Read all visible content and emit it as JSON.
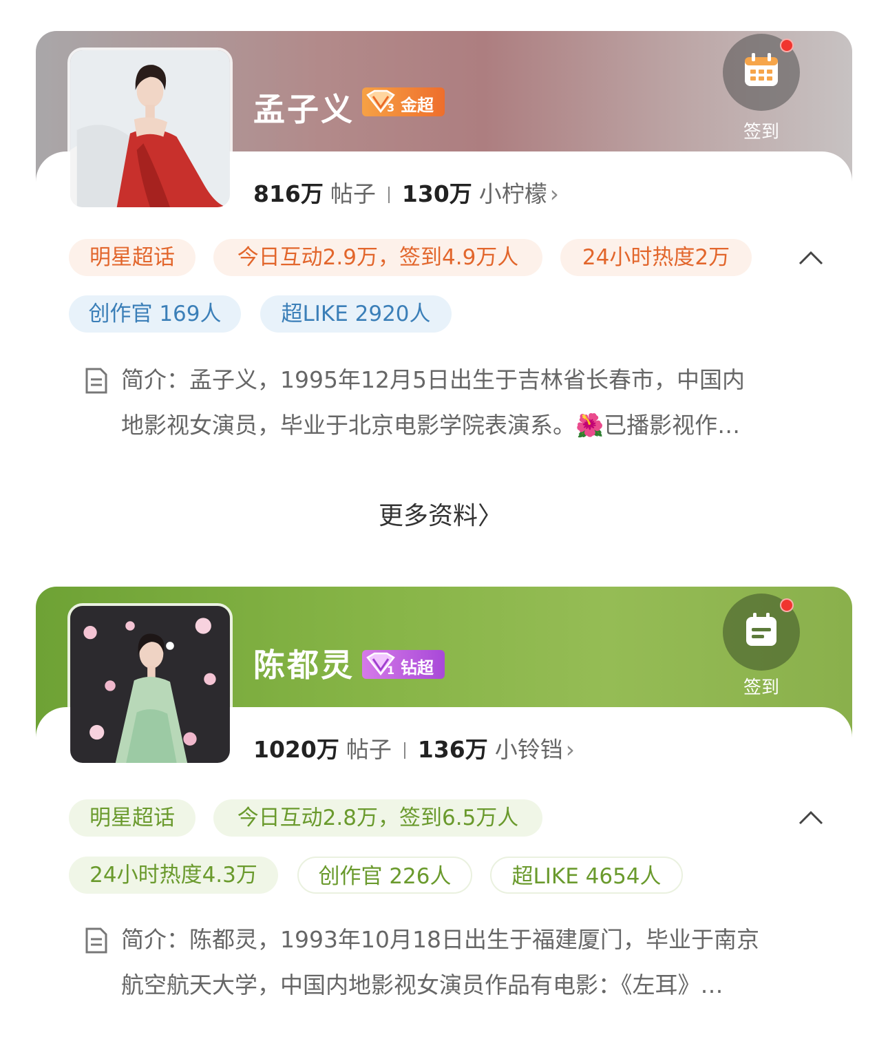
{
  "cards": [
    {
      "name": "孟子义",
      "badge": "金超",
      "checkin_label": "签到",
      "stats": {
        "posts_value": "816万",
        "posts_label": "帖子",
        "fans_value": "130万",
        "fans_label": "小柠檬",
        "chevron": "›"
      },
      "tags": [
        "明星超话",
        "今日互动2.9万，签到4.9万人",
        "24小时热度2万",
        "创作官 169人",
        "超LIKE 2920人"
      ],
      "intro_line1": "简介：孟子义，1995年12月5日出生于吉林省长春市，中国内",
      "intro_line2": "地影视女演员，毕业于北京电影学院表演系。🌺已播影视作…",
      "more_label": "更多资料",
      "more_chevron": "〉",
      "colors": {
        "banner": "#b08a8a",
        "tag_primary": "#e2662c",
        "tag_secondary": "#3b7fb8"
      },
      "icons": [
        "calendar-icon",
        "gem-icon",
        "document-icon",
        "chevron-up-icon"
      ]
    },
    {
      "name": "陈都灵",
      "badge": "钻超",
      "checkin_label": "签到",
      "stats": {
        "posts_value": "1020万",
        "posts_label": "帖子",
        "fans_value": "136万",
        "fans_label": "小铃铛",
        "chevron": "›"
      },
      "tags": [
        "明星超话",
        "今日互动2.8万，签到6.5万人",
        "24小时热度4.3万",
        "创作官 226人",
        "超LIKE 4654人"
      ],
      "intro_line1": "简介：陈都灵，1993年10月18日出生于福建厦门，毕业于南京",
      "intro_line2": "航空航天大学，中国内地影视女演员作品有电影：《左耳》…",
      "colors": {
        "banner": "#86b446",
        "tag_primary": "#6a9a2d"
      },
      "icons": [
        "notepad-icon",
        "gem-icon",
        "document-icon",
        "chevron-up-icon"
      ]
    }
  ]
}
